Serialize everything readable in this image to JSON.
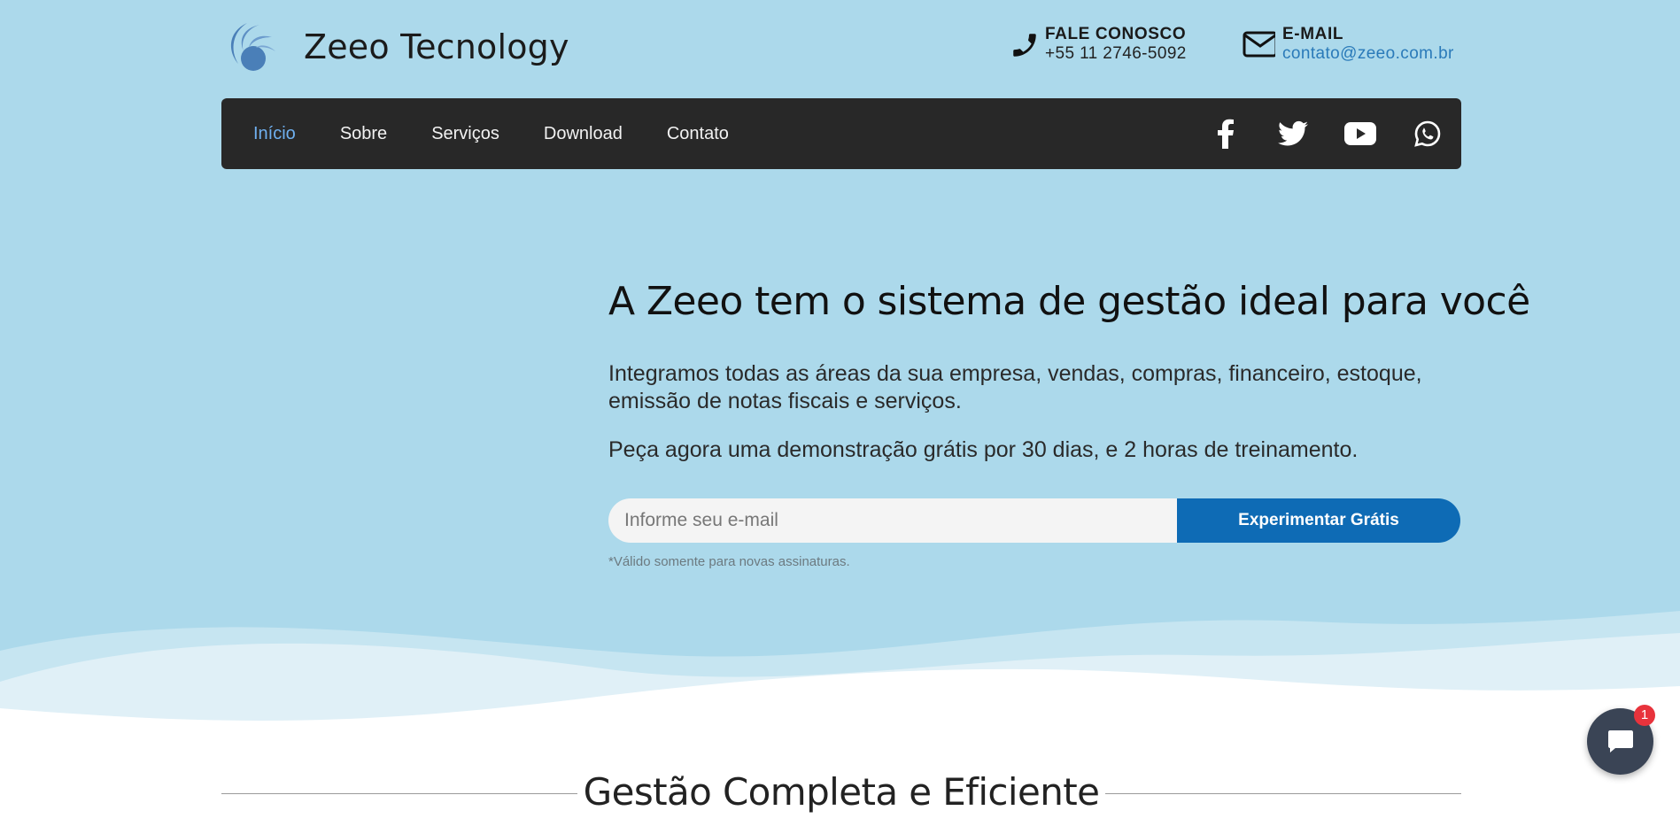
{
  "brand": {
    "name": "Zeeo Tecnology",
    "logo_icon": "swirl-logo-icon",
    "color": "#4a7fb8"
  },
  "contacts": {
    "phone": {
      "label": "FALE CONOSCO",
      "value": "+55 11 2746-5092",
      "icon": "phone-icon"
    },
    "email": {
      "label": "E-MAIL",
      "value": "contato@zeeo.com.br",
      "icon": "envelope-icon"
    }
  },
  "nav": {
    "items": [
      {
        "label": "Início",
        "active": true
      },
      {
        "label": "Sobre"
      },
      {
        "label": "Serviços"
      },
      {
        "label": "Download"
      },
      {
        "label": "Contato"
      }
    ],
    "social": [
      "facebook-icon",
      "twitter-icon",
      "youtube-icon",
      "whatsapp-icon"
    ]
  },
  "hero": {
    "headline": "A Zeeo tem o sistema de gestão ideal para você",
    "lead": "Integramos todas as áreas da sua empresa, vendas, compras, financeiro, estoque, emissão de notas fiscais e serviços.",
    "lead2": "Peça agora uma demonstração grátis por 30 dias, e 2 horas de treinamento.",
    "email_placeholder": "Informe seu e-mail",
    "cta_label": "Experimentar Grátis",
    "note": "*Válido somente para novas assinaturas."
  },
  "section": {
    "title": "Gestão Completa e Eficiente"
  },
  "chat": {
    "icon": "chat-bubble-icon",
    "badge": "1"
  },
  "colors": {
    "hero_bg": "#acd9eb",
    "navbar_bg": "#282828",
    "nav_active": "#6fb0f0",
    "cta_bg": "#0e6bb5",
    "link": "#2a7ab9",
    "badge": "#e8333c"
  }
}
